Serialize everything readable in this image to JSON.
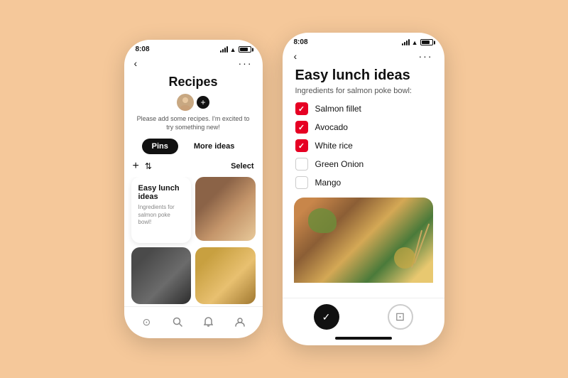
{
  "left_phone": {
    "status_time": "8:08",
    "nav": {
      "back": "‹",
      "more": "···"
    },
    "title": "Recipes",
    "subtitle": "Please add some recipes. I'm excited to try something new!",
    "tabs": [
      {
        "label": "Pins",
        "active": true
      },
      {
        "label": "More ideas",
        "active": false
      }
    ],
    "toolbar": {
      "add": "+",
      "select": "Select"
    },
    "pin_card": {
      "title": "Easy lunch ideas",
      "description": "Ingredients for salmon poke bowl!"
    },
    "bottom_nav": [
      {
        "icon": "⊙",
        "name": "home",
        "active": false
      },
      {
        "icon": "⌕",
        "name": "search",
        "active": false
      },
      {
        "icon": "🔔",
        "name": "notifications",
        "active": false
      },
      {
        "icon": "👤",
        "name": "profile",
        "active": false
      }
    ]
  },
  "right_phone": {
    "status_time": "8:08",
    "nav": {
      "back": "‹",
      "more": "···"
    },
    "title": "Easy lunch ideas",
    "subtitle": "Ingredients for salmon poke bowl:",
    "ingredients": [
      {
        "name": "Salmon fillet",
        "checked": true
      },
      {
        "name": "Avocado",
        "checked": true
      },
      {
        "name": "White rice",
        "checked": true
      },
      {
        "name": "Green Onion",
        "checked": false
      },
      {
        "name": "Mango",
        "checked": false
      }
    ],
    "bottom_icons": [
      {
        "label": "✓",
        "type": "filled"
      },
      {
        "label": "⊡",
        "type": "outline"
      }
    ]
  }
}
